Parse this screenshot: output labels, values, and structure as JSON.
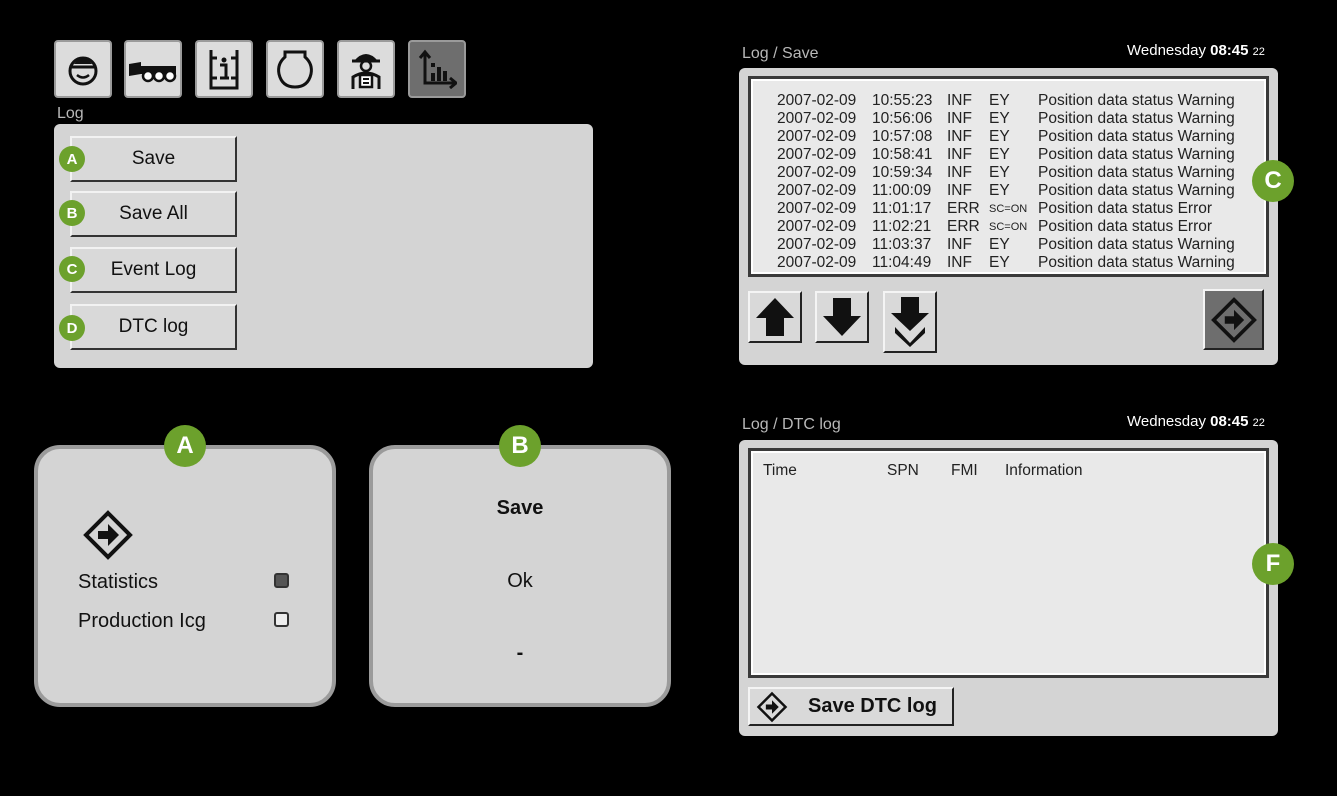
{
  "toolbar": {
    "icons": [
      "operator-icon",
      "machine-icon",
      "info-icon",
      "engine-icon",
      "technician-icon",
      "statistics-icon"
    ]
  },
  "log_menu": {
    "title": "Log",
    "items": [
      {
        "badge": "A",
        "label": "Save"
      },
      {
        "badge": "B",
        "label": "Save All"
      },
      {
        "badge": "C",
        "label": "Event Log"
      },
      {
        "badge": "D",
        "label": "DTC log"
      }
    ]
  },
  "dialog_a": {
    "badge": "A",
    "options": [
      {
        "label": "Statistics",
        "checked": true
      },
      {
        "label": "Production Icg",
        "checked": false
      }
    ]
  },
  "dialog_b": {
    "badge": "B",
    "title": "Save",
    "status": "Ok",
    "value": "-"
  },
  "event_log": {
    "breadcrumb": "Log / Save",
    "datetime": {
      "day": "Wednesday",
      "time": "08:45",
      "seconds": "22"
    },
    "badge": "C",
    "rows": [
      {
        "date": "2007-02-09",
        "time": "10:55:23",
        "level": "INF",
        "source": "EY",
        "message": "Position data status Warning"
      },
      {
        "date": "2007-02-09",
        "time": "10:56:06",
        "level": "INF",
        "source": "EY",
        "message": "Position data status Warning"
      },
      {
        "date": "2007-02-09",
        "time": "10:57:08",
        "level": "INF",
        "source": "EY",
        "message": "Position data status Warning"
      },
      {
        "date": "2007-02-09",
        "time": "10:58:41",
        "level": "INF",
        "source": "EY",
        "message": "Position data status Warning"
      },
      {
        "date": "2007-02-09",
        "time": "10:59:34",
        "level": "INF",
        "source": "EY",
        "message": "Position data status Warning"
      },
      {
        "date": "2007-02-09",
        "time": "11:00:09",
        "level": "INF",
        "source": "EY",
        "message": "Position data status Warning"
      },
      {
        "date": "2007-02-09",
        "time": "11:01:17",
        "level": "ERR",
        "source": "SC=ON",
        "message": "Position data status Error"
      },
      {
        "date": "2007-02-09",
        "time": "11:02:21",
        "level": "ERR",
        "source": "SC=ON",
        "message": "Position data status Error"
      },
      {
        "date": "2007-02-09",
        "time": "11:03:37",
        "level": "INF",
        "source": "EY",
        "message": "Position data status Warning"
      },
      {
        "date": "2007-02-09",
        "time": "11:04:49",
        "level": "INF",
        "source": "EY",
        "message": "Position data status Warning"
      }
    ]
  },
  "dtc_log": {
    "breadcrumb": "Log / DTC log",
    "datetime": {
      "day": "Wednesday",
      "time": "08:45",
      "seconds": "22"
    },
    "badge": "F",
    "columns": [
      "Time",
      "SPN",
      "FMI",
      "Information"
    ],
    "save_label": "Save DTC log"
  }
}
